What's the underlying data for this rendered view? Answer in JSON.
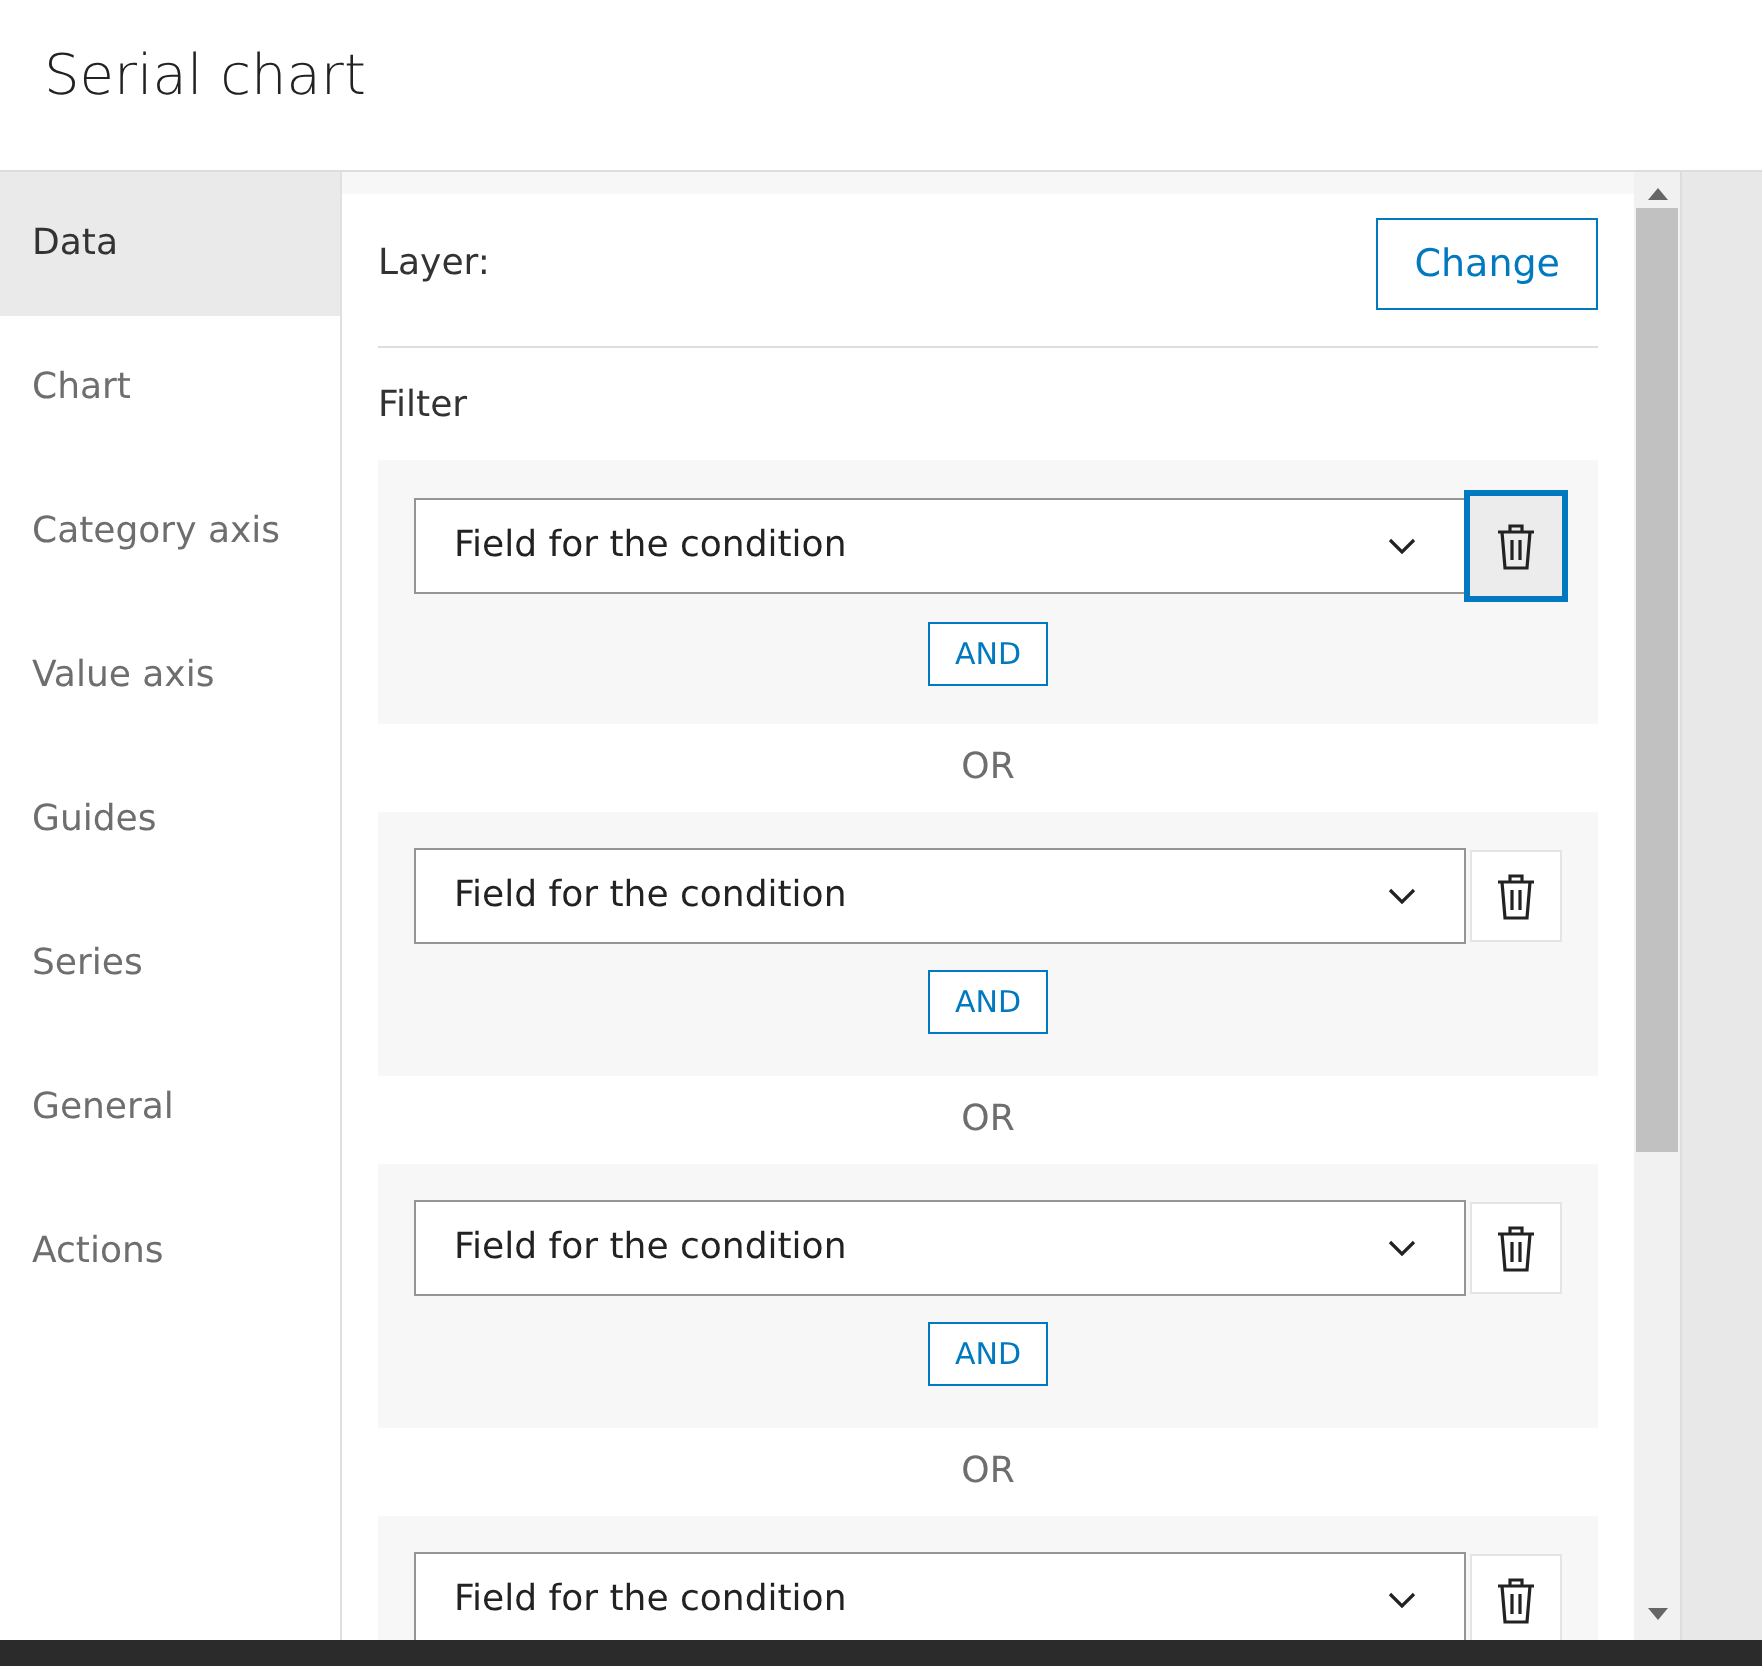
{
  "window": {
    "title": "Serial chart"
  },
  "sidebar": {
    "items": [
      {
        "label": "Data",
        "selected": true
      },
      {
        "label": "Chart",
        "selected": false
      },
      {
        "label": "Category axis",
        "selected": false
      },
      {
        "label": "Value axis",
        "selected": false
      },
      {
        "label": "Guides",
        "selected": false
      },
      {
        "label": "Series",
        "selected": false
      },
      {
        "label": "General",
        "selected": false
      },
      {
        "label": "Actions",
        "selected": false
      }
    ]
  },
  "layer": {
    "label": "Layer:",
    "button": "Change"
  },
  "filter": {
    "label": "Filter",
    "groups": [
      {
        "placeholder": "Field for the condition",
        "and_label": "AND",
        "delete_focused": true
      },
      {
        "separator": "OR",
        "placeholder": "Field for the condition",
        "and_label": "AND",
        "delete_focused": false
      },
      {
        "separator": "OR",
        "placeholder": "Field for the condition",
        "and_label": "AND",
        "delete_focused": false
      },
      {
        "separator": "OR",
        "placeholder": "Field for the condition",
        "delete_focused": false
      }
    ]
  }
}
